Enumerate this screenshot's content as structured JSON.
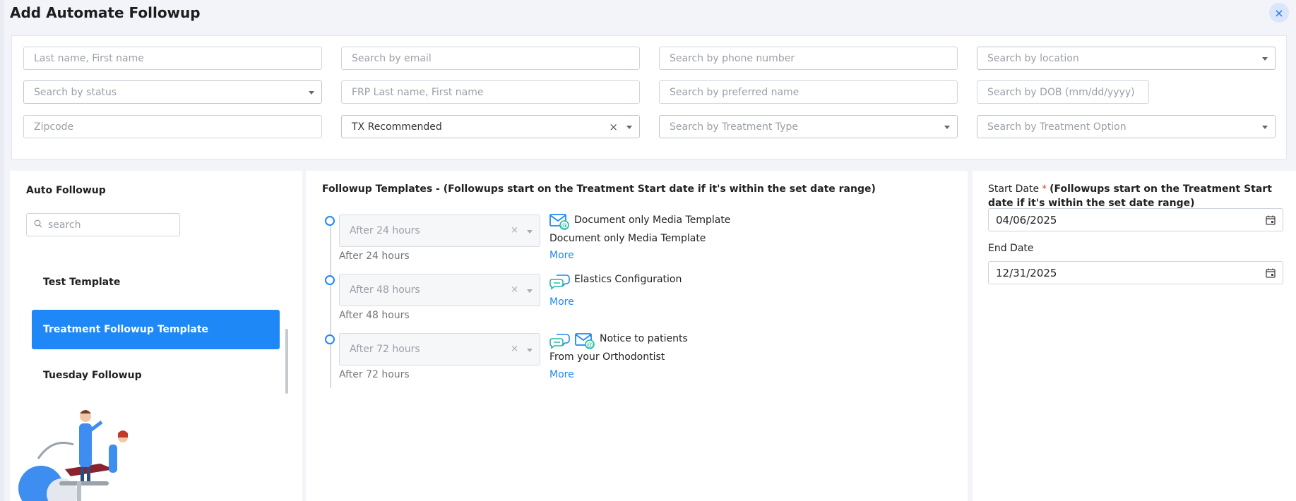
{
  "title": "Add Automate Followup",
  "close_label": "×",
  "filters": {
    "name_placeholder": "Last name, First name",
    "email_placeholder": "Search by email",
    "phone_placeholder": "Search by phone number",
    "location_placeholder": "Search by location",
    "status_placeholder": "Search by status",
    "frp_placeholder": "FRP Last name, First name",
    "preferred_placeholder": "Search by preferred name",
    "dob_placeholder": "Search by DOB (mm/dd/yyyy)",
    "zip_placeholder": "Zipcode",
    "tx_status_value": "TX Recommended",
    "treatment_type_placeholder": "Search by Treatment Type",
    "treatment_option_placeholder": "Search by Treatment Option",
    "clear_glyph": "×"
  },
  "auto_followup": {
    "heading": "Auto Followup",
    "search_placeholder": "search",
    "templates": [
      {
        "label": "Test Template",
        "active": false
      },
      {
        "label": "Treatment Followup Template",
        "active": true
      },
      {
        "label": "Tuesday Followup",
        "active": false
      }
    ]
  },
  "followup_templates": {
    "heading": "Followup Templates - (Followups start on the Treatment Start date if it's within the set date range)",
    "steps": [
      {
        "delay": "After 24 hours",
        "delay_label": "After 24 hours",
        "icons": [
          "email-icon"
        ],
        "name": "Document only Media Template",
        "description": "Document only Media Template",
        "more": "More"
      },
      {
        "delay": "After 48 hours",
        "delay_label": "After 48 hours",
        "icons": [
          "sms-icon"
        ],
        "name": "Elastics Configuration",
        "description": "",
        "more": "More"
      },
      {
        "delay": "After 72 hours",
        "delay_label": "After 72 hours",
        "icons": [
          "sms-icon",
          "email-icon"
        ],
        "name": "Notice to patients",
        "description": "From your Orthodontist",
        "more": "More"
      }
    ]
  },
  "dates": {
    "start_label": "Start Date",
    "required_mark": "*",
    "start_note": "(Followups start on the Treatment Start date if it's within the set date range)",
    "start_value": "04/06/2025",
    "end_label": "End Date",
    "end_value": "12/31/2025"
  },
  "colors": {
    "accent": "#1e88f7",
    "icon_teal": "#1fb8a3"
  }
}
